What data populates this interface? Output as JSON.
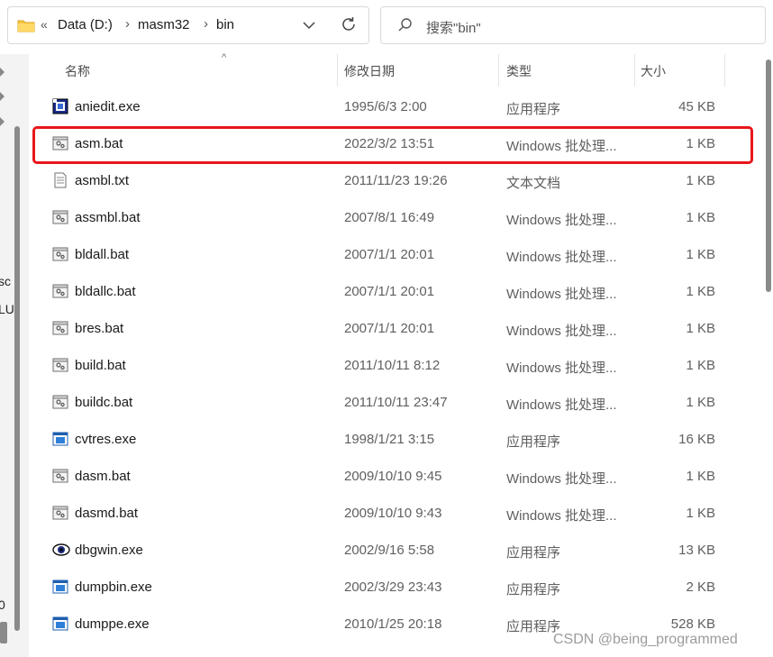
{
  "address": {
    "overflow": "«",
    "crumbs": [
      "Data (D:)",
      "masm32",
      "bin"
    ]
  },
  "search": {
    "placeholder": "搜索\"bin\""
  },
  "left_fragments": [
    "sc",
    "LU",
    "0"
  ],
  "columns": {
    "name": "名称",
    "date": "修改日期",
    "type": "类型",
    "size": "大小"
  },
  "files": [
    {
      "name": "aniedit.exe",
      "date": "1995/6/3 2:00",
      "type": "应用程序",
      "size": "45 KB",
      "icon": "aniedit-app-icon"
    },
    {
      "name": "asm.bat",
      "date": "2022/3/2 13:51",
      "type": "Windows 批处理...",
      "size": "1 KB",
      "icon": "batch-file-icon",
      "highlighted": true
    },
    {
      "name": "asmbl.txt",
      "date": "2011/11/23 19:26",
      "type": "文本文档",
      "size": "1 KB",
      "icon": "text-file-icon"
    },
    {
      "name": "assmbl.bat",
      "date": "2007/8/1 16:49",
      "type": "Windows 批处理...",
      "size": "1 KB",
      "icon": "batch-file-icon"
    },
    {
      "name": "bldall.bat",
      "date": "2007/1/1 20:01",
      "type": "Windows 批处理...",
      "size": "1 KB",
      "icon": "batch-file-icon"
    },
    {
      "name": "bldallc.bat",
      "date": "2007/1/1 20:01",
      "type": "Windows 批处理...",
      "size": "1 KB",
      "icon": "batch-file-icon"
    },
    {
      "name": "bres.bat",
      "date": "2007/1/1 20:01",
      "type": "Windows 批处理...",
      "size": "1 KB",
      "icon": "batch-file-icon"
    },
    {
      "name": "build.bat",
      "date": "2011/10/11 8:12",
      "type": "Windows 批处理...",
      "size": "1 KB",
      "icon": "batch-file-icon"
    },
    {
      "name": "buildc.bat",
      "date": "2011/10/11 23:47",
      "type": "Windows 批处理...",
      "size": "1 KB",
      "icon": "batch-file-icon"
    },
    {
      "name": "cvtres.exe",
      "date": "1998/1/21 3:15",
      "type": "应用程序",
      "size": "16 KB",
      "icon": "app-window-icon"
    },
    {
      "name": "dasm.bat",
      "date": "2009/10/10 9:45",
      "type": "Windows 批处理...",
      "size": "1 KB",
      "icon": "batch-file-icon"
    },
    {
      "name": "dasmd.bat",
      "date": "2009/10/10 9:43",
      "type": "Windows 批处理...",
      "size": "1 KB",
      "icon": "batch-file-icon"
    },
    {
      "name": "dbgwin.exe",
      "date": "2002/9/16 5:58",
      "type": "应用程序",
      "size": "13 KB",
      "icon": "eye-app-icon"
    },
    {
      "name": "dumpbin.exe",
      "date": "2002/3/29 23:43",
      "type": "应用程序",
      "size": "2 KB",
      "icon": "app-window-icon"
    },
    {
      "name": "dumppe.exe",
      "date": "2010/1/25 20:18",
      "type": "应用程序",
      "size": "528 KB",
      "icon": "app-window-icon"
    }
  ],
  "watermark": "CSDN @being_programmed"
}
